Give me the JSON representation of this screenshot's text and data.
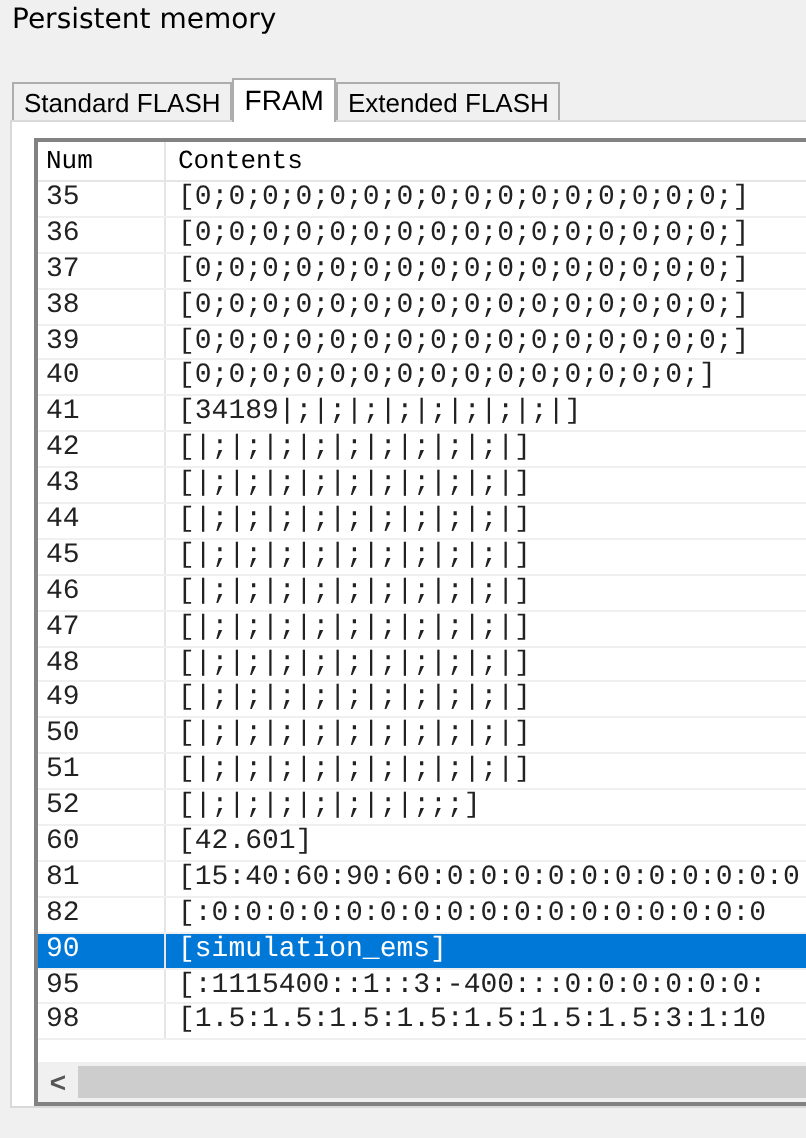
{
  "window": {
    "title": "Persistent memory"
  },
  "tabs": [
    {
      "label": "Standard FLASH",
      "selected": false
    },
    {
      "label": "FRAM",
      "selected": true
    },
    {
      "label": "Extended FLASH",
      "selected": false
    }
  ],
  "table": {
    "columns": [
      "Num",
      "Contents"
    ],
    "rows": [
      {
        "num": "35",
        "contents": "[0;0;0;0;0;0;0;0;0;0;0;0;0;0;0;0;]",
        "selected": false
      },
      {
        "num": "36",
        "contents": "[0;0;0;0;0;0;0;0;0;0;0;0;0;0;0;0;]",
        "selected": false
      },
      {
        "num": "37",
        "contents": "[0;0;0;0;0;0;0;0;0;0;0;0;0;0;0;0;]",
        "selected": false
      },
      {
        "num": "38",
        "contents": "[0;0;0;0;0;0;0;0;0;0;0;0;0;0;0;0;]",
        "selected": false
      },
      {
        "num": "39",
        "contents": "[0;0;0;0;0;0;0;0;0;0;0;0;0;0;0;0;]",
        "selected": false
      },
      {
        "num": "40",
        "contents": "[0;0;0;0;0;0;0;0;0;0;0;0;0;0;0;]",
        "selected": false
      },
      {
        "num": "41",
        "contents": "[34189|;|;|;|;|;|;|;|;|]",
        "selected": false
      },
      {
        "num": "42",
        "contents": "[|;|;|;|;|;|;|;|;|;|]",
        "selected": false
      },
      {
        "num": "43",
        "contents": "[|;|;|;|;|;|;|;|;|;|]",
        "selected": false
      },
      {
        "num": "44",
        "contents": "[|;|;|;|;|;|;|;|;|;|]",
        "selected": false
      },
      {
        "num": "45",
        "contents": "[|;|;|;|;|;|;|;|;|;|]",
        "selected": false
      },
      {
        "num": "46",
        "contents": "[|;|;|;|;|;|;|;|;|;|]",
        "selected": false
      },
      {
        "num": "47",
        "contents": "[|;|;|;|;|;|;|;|;|;|]",
        "selected": false
      },
      {
        "num": "48",
        "contents": "[|;|;|;|;|;|;|;|;|;|]",
        "selected": false
      },
      {
        "num": "49",
        "contents": "[|;|;|;|;|;|;|;|;|;|]",
        "selected": false
      },
      {
        "num": "50",
        "contents": "[|;|;|;|;|;|;|;|;|;|]",
        "selected": false
      },
      {
        "num": "51",
        "contents": "[|;|;|;|;|;|;|;|;|;|]",
        "selected": false
      },
      {
        "num": "52",
        "contents": "[|;|;|;|;|;|;|;;;]",
        "selected": false
      },
      {
        "num": "60",
        "contents": "[42.601]",
        "selected": false
      },
      {
        "num": "81",
        "contents": "[15:40:60:90:60:0:0:0:0:0:0:0:0:0:0:0",
        "selected": false
      },
      {
        "num": "82",
        "contents": "[:0:0:0:0:0:0:0:0:0:0:0:0:0:0:0:0:0",
        "selected": false
      },
      {
        "num": "90",
        "contents": "[simulation_ems]",
        "selected": true
      },
      {
        "num": "95",
        "contents": "[:1115400::1::3:-400:::0:0:0:0:0:0:",
        "selected": false
      },
      {
        "num": "98",
        "contents": "[1.5:1.5:1.5:1.5:1.5:1.5:1.5:3:1:10",
        "selected": false
      }
    ]
  },
  "scroll_left": "<"
}
